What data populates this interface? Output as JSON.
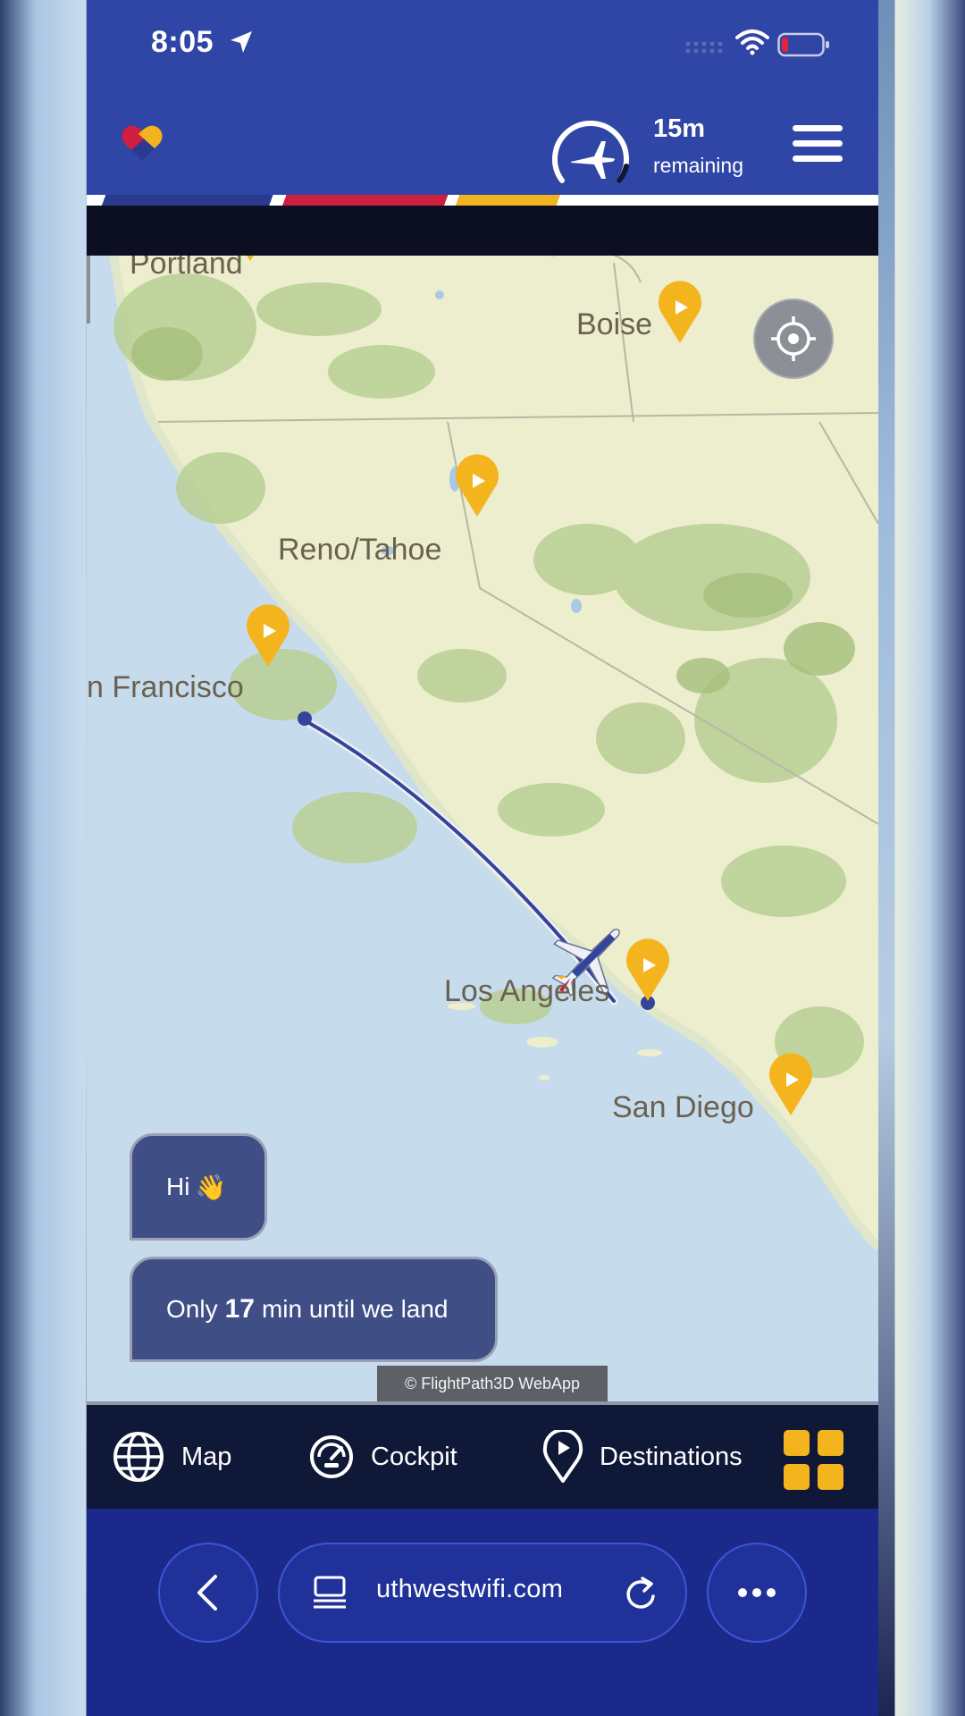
{
  "status_bar": {
    "time": "8:05"
  },
  "header": {
    "remaining_value": "15m",
    "remaining_label": "remaining",
    "colors": {
      "brand_blue": "#3046a6",
      "red": "#cf1f3f",
      "yellow": "#f2b320"
    }
  },
  "map": {
    "labels": {
      "portland": "Portland",
      "boise": "Boise",
      "reno_tahoe": "Reno/Tahoe",
      "san_francisco": "n Francisco",
      "los_angeles": "Los Angeles",
      "san_diego": "San Diego"
    },
    "copyright": "© FlightPath3D WebApp"
  },
  "chat": {
    "greeting": "Hi",
    "greeting_emoji": "👋",
    "landing_prefix": "Only",
    "landing_minutes": "17",
    "landing_suffix": "min until we land"
  },
  "tabs": {
    "map": "Map",
    "cockpit": "Cockpit",
    "destinations": "Destinations"
  },
  "browser": {
    "url": "uthwestwifi.com"
  },
  "icons": {
    "location_arrow": "location-arrow-icon",
    "signal": "cellular-signal-icon",
    "wifi": "wifi-icon",
    "battery": "battery-low-icon",
    "logo": "heart-logo-icon",
    "gauge": "flight-progress-gauge-icon",
    "menu": "hamburger-menu-icon",
    "locate": "crosshair-locate-icon",
    "globe": "globe-icon",
    "cockpit": "speedometer-icon",
    "destinations": "map-pin-icon",
    "grid": "grid-apps-icon",
    "back": "chevron-left-icon",
    "reader": "reader-icon",
    "reload": "reload-icon",
    "more": "more-dots-icon",
    "airplane": "airplane-icon"
  }
}
